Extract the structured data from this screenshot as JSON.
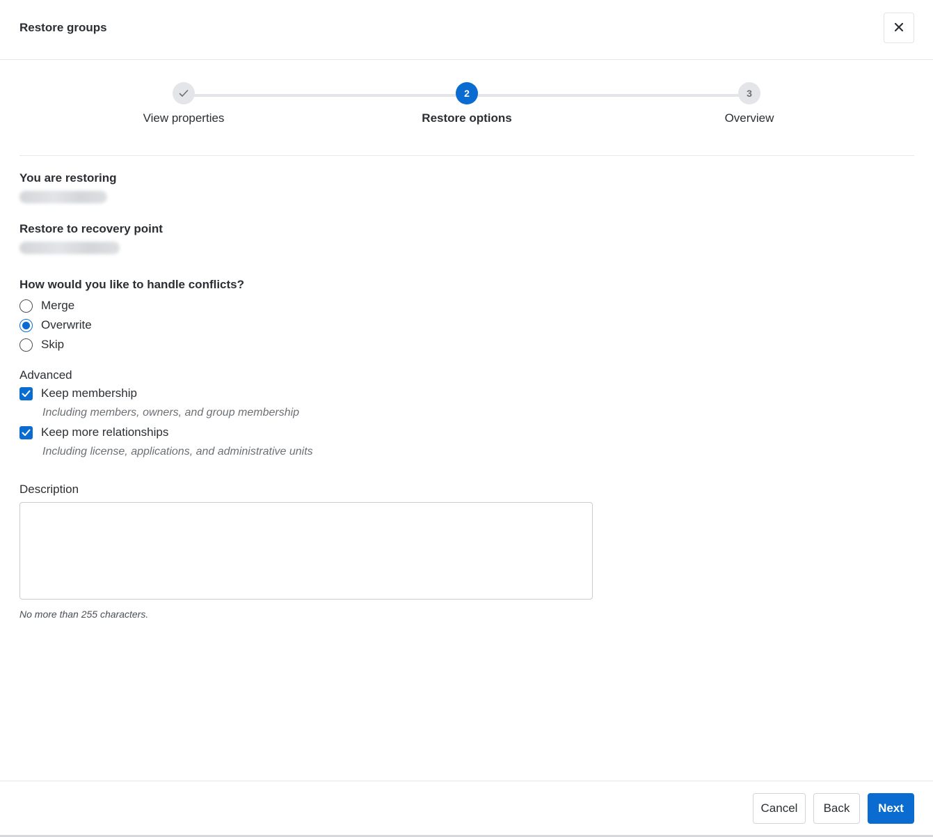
{
  "dialog": {
    "title": "Restore groups",
    "close_icon": "close-icon"
  },
  "stepper": {
    "steps": [
      {
        "label": "View properties",
        "marker": "✓",
        "state": "done"
      },
      {
        "label": "Restore options",
        "marker": "2",
        "state": "active"
      },
      {
        "label": "Overview",
        "marker": "3",
        "state": "pending"
      }
    ]
  },
  "restoring": {
    "label": "You are restoring",
    "value_redacted": true
  },
  "recovery_point": {
    "label": "Restore to recovery point",
    "value_redacted": true
  },
  "conflicts": {
    "question": "How would you like to handle conflicts?",
    "options": [
      "Merge",
      "Overwrite",
      "Skip"
    ],
    "selected": "Overwrite"
  },
  "advanced": {
    "label": "Advanced",
    "keep_membership": {
      "label": "Keep membership",
      "description": "Including members, owners, and group membership",
      "checked": true
    },
    "keep_relationships": {
      "label": "Keep more relationships",
      "description": "Including license, applications, and administrative units",
      "checked": true
    }
  },
  "description": {
    "label": "Description",
    "value": "",
    "hint": "No more than 255 characters."
  },
  "footer": {
    "cancel_label": "Cancel",
    "back_label": "Back",
    "next_label": "Next"
  },
  "colors": {
    "accent": "#0a6bd1",
    "step_inactive": "#e3e5e8"
  }
}
